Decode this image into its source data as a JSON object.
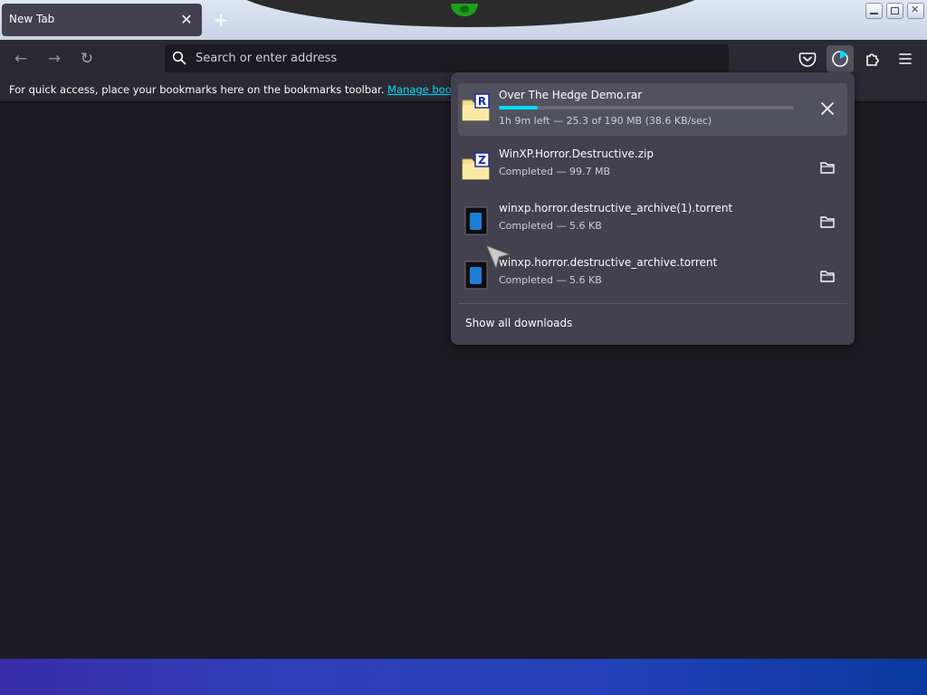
{
  "tab": {
    "title": "New Tab",
    "close_glyph": "✕",
    "new_tab_glyph": "+"
  },
  "window_controls": [
    "minimize-icon",
    "maximize-icon",
    "close-icon"
  ],
  "nav": {
    "back_icon": "arrow-left-icon",
    "forward_icon": "arrow-right-icon",
    "reload_icon": "reload-icon",
    "back_glyph": "←",
    "forward_glyph": "→",
    "reload_glyph": "↻"
  },
  "urlbar": {
    "placeholder": "Search or enter address",
    "value": ""
  },
  "toolbar_icons": [
    "pocket-icon",
    "downloads-icon",
    "extensions-icon",
    "menu-icon"
  ],
  "bookmarks": {
    "message": "For quick access, place your bookmarks here on the bookmarks toolbar.",
    "link_label": "Manage bookmarks..."
  },
  "downloads": {
    "items": [
      {
        "name": "Over The Hedge Demo.rar",
        "status": "1h 9m left — 25.3 of 190 MB (38.6 KB/sec)",
        "progress_fraction": 0.133,
        "icon": "rar-archive-icon",
        "badge": "R",
        "action": "cancel-icon"
      },
      {
        "name": "WinXP.Horror.Destructive.zip",
        "status": "Completed — 99.7 MB",
        "icon": "zip-archive-icon",
        "badge": "Z",
        "action": "folder-icon"
      },
      {
        "name": "winxp.horror.destructive_archive(1).torrent",
        "status": "Completed — 5.6 KB",
        "icon": "torrent-file-icon",
        "action": "folder-icon"
      },
      {
        "name": "winxp.horror.destructive_archive.torrent",
        "status": "Completed — 5.6 KB",
        "icon": "torrent-file-icon",
        "action": "folder-icon"
      }
    ],
    "show_all_label": "Show all downloads"
  },
  "colors": {
    "accent": "#00ddff",
    "toolbar": "#2b2a33",
    "content": "#1c1b22",
    "panel": "#42414d"
  }
}
